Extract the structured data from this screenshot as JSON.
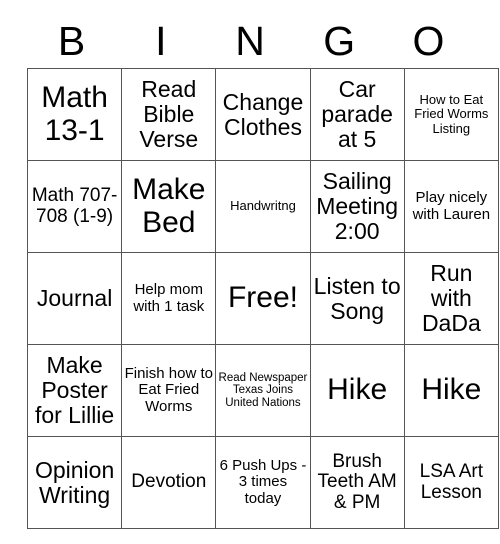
{
  "card": {
    "header_letters": [
      "B",
      "I",
      "N",
      "G",
      "O"
    ],
    "rows": [
      [
        {
          "text": "Math 13-1",
          "size": "xxl"
        },
        {
          "text": "Read Bible Verse",
          "size": "lg"
        },
        {
          "text": "Change Clothes",
          "size": "lg"
        },
        {
          "text": "Car parade at 5",
          "size": "lg"
        },
        {
          "text": "How to Eat Fried Worms Listing",
          "size": "xs"
        }
      ],
      [
        {
          "text": "Math 707-708 (1-9)",
          "size": "md"
        },
        {
          "text": "Make Bed",
          "size": "xxl"
        },
        {
          "text": "Handwritng",
          "size": "xs"
        },
        {
          "text": "Sailing Meeting 2:00",
          "size": "lg"
        },
        {
          "text": "Play nicely with Lauren",
          "size": "sm"
        }
      ],
      [
        {
          "text": "Journal",
          "size": "lg"
        },
        {
          "text": "Help mom with 1 task",
          "size": "sm"
        },
        {
          "text": "Free!",
          "size": "xxl"
        },
        {
          "text": "Listen to Song",
          "size": "lg"
        },
        {
          "text": "Run with DaDa",
          "size": "lg"
        }
      ],
      [
        {
          "text": "Make Poster for Lillie",
          "size": "lg"
        },
        {
          "text": "Finish how to Eat Fried Worms",
          "size": "sm"
        },
        {
          "text": "Read Newspaper Texas Joins United Nations",
          "size": "xxs"
        },
        {
          "text": "Hike",
          "size": "xxl"
        },
        {
          "text": "Hike",
          "size": "xxl"
        }
      ],
      [
        {
          "text": "Opinion Writing",
          "size": "lg"
        },
        {
          "text": "Devotion",
          "size": "md"
        },
        {
          "text": "6 Push Ups - 3 times today",
          "size": "sm"
        },
        {
          "text": "Brush Teeth AM & PM",
          "size": "md"
        },
        {
          "text": "LSA Art Lesson",
          "size": "md"
        }
      ]
    ]
  }
}
